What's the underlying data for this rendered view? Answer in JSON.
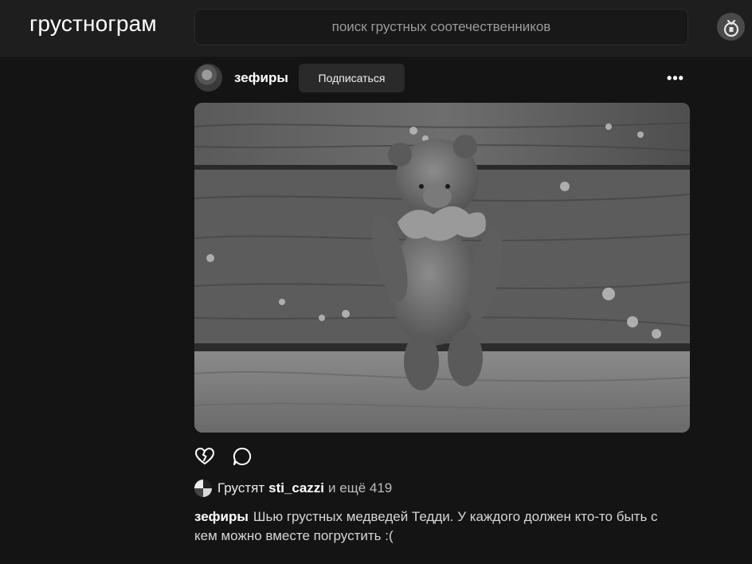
{
  "app": {
    "logo": "грустнограм"
  },
  "search": {
    "placeholder": "поиск грустных соотечественников"
  },
  "post": {
    "username": "зефиры",
    "subscribe_label": "Подписаться",
    "more_label": "•••",
    "likes": {
      "prefix": "Грустят",
      "user": "sti_cazzi",
      "suffix": "и ещё 419"
    },
    "caption": {
      "user": "зефиры",
      "text": "Шью грустных медведей Тедди. У каждого должен кто-то быть с кем можно вместе погрустить :("
    }
  },
  "icons": {
    "profile": "profile-icon",
    "like": "broken-heart-icon",
    "comment": "comment-icon"
  },
  "colors": {
    "background": "#141414",
    "topbar": "#1e1e1e",
    "search_bg": "#181818",
    "button_bg": "#2a2a2a"
  }
}
